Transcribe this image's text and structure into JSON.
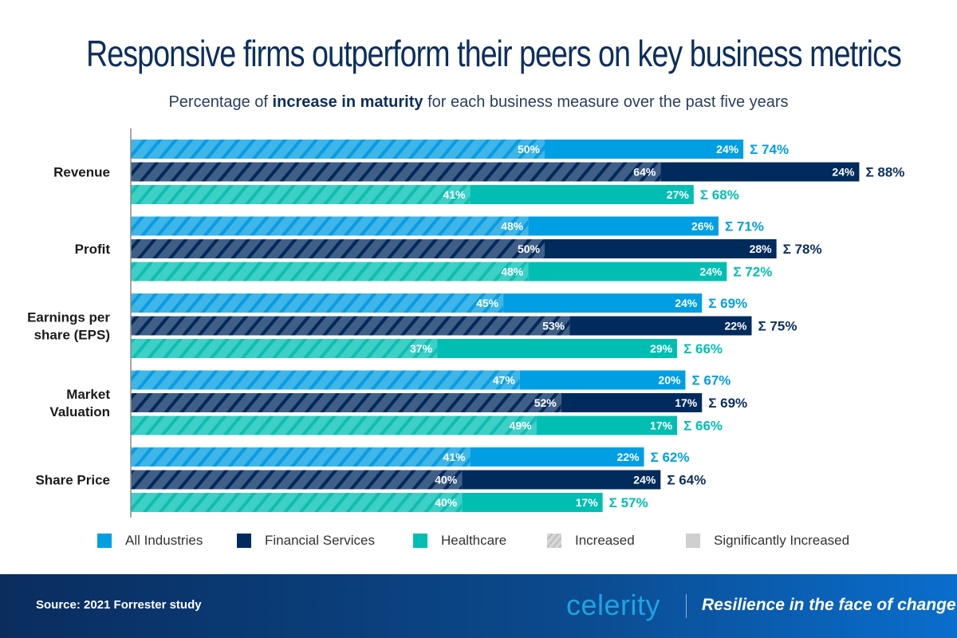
{
  "header": {
    "title": "Responsive firms outperform their peers on key business metrics",
    "subtitle_pre": "Percentage of ",
    "subtitle_bold": "increase in maturity",
    "subtitle_post": " for each business measure over the past five years"
  },
  "colors": {
    "all_industries": "#009fe3",
    "all_industries_hatch": "#3eb6e8",
    "financial_services": "#002b5c",
    "financial_services_hatch": "#3f5f86",
    "healthcare": "#00bfb2",
    "healthcare_hatch": "#3dd0c6",
    "total_all": "#009fe3",
    "total_fin": "#0c2f5c",
    "total_health": "#00bfb2"
  },
  "chart_data": {
    "type": "bar",
    "orientation": "horizontal",
    "stacked": true,
    "title": "Responsive firms outperform their peers on key business metrics",
    "subtitle": "Percentage of increase in maturity for each business measure over the past five years",
    "categories": [
      "Revenue",
      "Profit",
      "Earnings per share (EPS)",
      "Market Valuation",
      "Share Price"
    ],
    "category_labels": [
      [
        "Revenue"
      ],
      [
        "Profit"
      ],
      [
        "Earnings per",
        "share (EPS)"
      ],
      [
        "Market",
        "Valuation"
      ],
      [
        "Share Price"
      ]
    ],
    "groups": [
      "All Industries",
      "Financial Services",
      "Healthcare"
    ],
    "stack_segments": [
      "Increased",
      "Significantly Increased"
    ],
    "series": [
      {
        "name": "All Industries",
        "increased": [
          50,
          48,
          45,
          47,
          41
        ],
        "significantly_increased": [
          24,
          26,
          24,
          20,
          22
        ],
        "total": [
          74,
          71,
          69,
          67,
          62
        ]
      },
      {
        "name": "Financial Services",
        "increased": [
          64,
          50,
          53,
          52,
          40
        ],
        "significantly_increased": [
          24,
          28,
          22,
          17,
          24
        ],
        "total": [
          88,
          78,
          75,
          69,
          64
        ]
      },
      {
        "name": "Healthcare",
        "increased": [
          41,
          48,
          37,
          49,
          40
        ],
        "significantly_increased": [
          27,
          24,
          29,
          17,
          17
        ],
        "total": [
          68,
          72,
          66,
          66,
          57
        ]
      }
    ],
    "total_prefix": "Σ",
    "xlim": [
      0,
      100
    ],
    "grid": false,
    "legend_position": "bottom"
  },
  "legend": [
    {
      "label": "All Industries",
      "kind": "all"
    },
    {
      "label": "Financial Services",
      "kind": "fin"
    },
    {
      "label": "Healthcare",
      "kind": "health"
    },
    {
      "label": "Increased",
      "kind": "hatch"
    },
    {
      "label": "Significantly Increased",
      "kind": "solid"
    }
  ],
  "footer": {
    "source": "Source: 2021 Forrester study",
    "logo": "celerity",
    "tagline": "Resilience in the face of change"
  }
}
